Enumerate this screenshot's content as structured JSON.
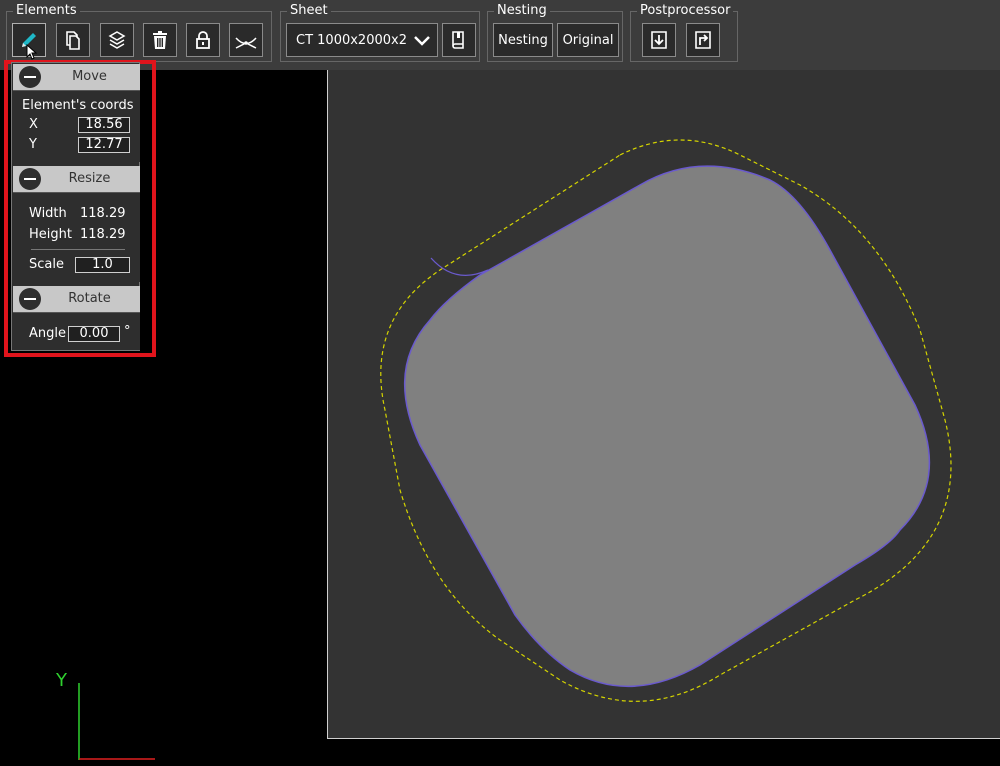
{
  "toolbar": {
    "elements": {
      "title": "Elements",
      "buttons": [
        "pencil-icon",
        "copy-icon",
        "layers-icon",
        "trash-icon",
        "lock-icon",
        "bend-icon"
      ]
    },
    "sheet": {
      "title": "Sheet",
      "selected": "CT 1000x2000x2",
      "book_icon": "book-icon"
    },
    "nesting": {
      "title": "Nesting",
      "nesting_label": "Nesting",
      "original_label": "Original"
    },
    "postprocessor": {
      "title": "Postprocessor",
      "buttons": [
        "download-icon",
        "export-icon"
      ]
    }
  },
  "panel": {
    "move": {
      "title": "Move",
      "subtitle": "Element's coords",
      "x_label": "X",
      "x_value": "18.56",
      "y_label": "Y",
      "y_value": "12.77"
    },
    "resize": {
      "title": "Resize",
      "width_label": "Width",
      "width_value": "118.29",
      "height_label": "Height",
      "height_value": "118.29",
      "scale_label": "Scale",
      "scale_value": "1.0"
    },
    "rotate": {
      "title": "Rotate",
      "angle_label": "Angle",
      "angle_value": "0.00",
      "angle_unit": "°"
    }
  },
  "axes": {
    "y_label": "Y"
  },
  "colors": {
    "accent": "#1fb8c8",
    "highlight": "#e0141c",
    "shape_fill": "#808080",
    "contour": "#6a5acd",
    "offset_line": "#d4d400",
    "axis_y": "#2fd02f",
    "axis_x": "#e02020"
  }
}
